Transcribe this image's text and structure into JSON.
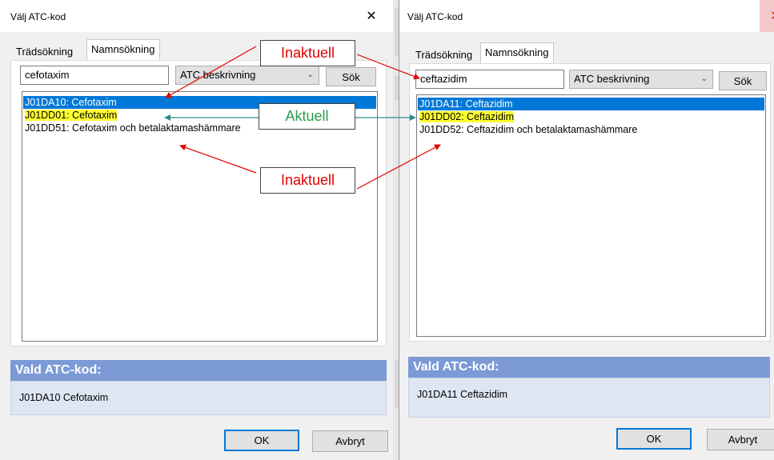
{
  "left": {
    "title": "Välj ATC-kod",
    "close": "✕",
    "tabs": [
      {
        "label": "Trädsökning",
        "active": false
      },
      {
        "label": "Namnsökning",
        "active": true
      }
    ],
    "search_value": "cefotaxim",
    "select_value": "ATC beskrivning",
    "search_button": "Sök",
    "rows": [
      {
        "text": "J01DA10: Cefotaxim",
        "selected": true,
        "highlight": false
      },
      {
        "text": "J01DD01: Cefotaxim",
        "selected": false,
        "highlight": true
      },
      {
        "text": "J01DD51: Cefotaxim och betalaktamashämmare",
        "selected": false,
        "highlight": false
      }
    ],
    "vald_header": "Vald ATC-kod:",
    "vald_value": "J01DA10 Cefotaxim",
    "ok": "OK",
    "cancel": "Avbryt"
  },
  "right": {
    "title": "Välj ATC-kod",
    "close": "✕",
    "tabs": [
      {
        "label": "Trädsökning",
        "active": false
      },
      {
        "label": "Namnsökning",
        "active": true
      }
    ],
    "search_value": "ceftazidim",
    "select_value": "ATC beskrivning",
    "search_button": "Sök",
    "rows": [
      {
        "text": "J01DA11: Ceftazidim",
        "selected": true,
        "highlight": false
      },
      {
        "text": "J01DD02: Ceftazidim",
        "selected": false,
        "highlight": true
      },
      {
        "text": "J01DD52: Ceftazidim och betalaktamashämmare",
        "selected": false,
        "highlight": false
      }
    ],
    "vald_header": "Vald ATC-kod:",
    "vald_value": "J01DA11 Ceftazidim",
    "ok": "OK",
    "cancel": "Avbryt"
  },
  "annotations": {
    "inaktuell_top": "Inaktuell",
    "aktuell": "Aktuell",
    "inaktuell_bottom": "Inaktuell"
  },
  "colors": {
    "selection": "#0078d7",
    "highlight": "#ffff33",
    "vald_header": "#7b9ad6",
    "vald_body": "#dee6f3",
    "red_arrow": "#e00000",
    "teal_arrow": "#2e8b8b"
  }
}
